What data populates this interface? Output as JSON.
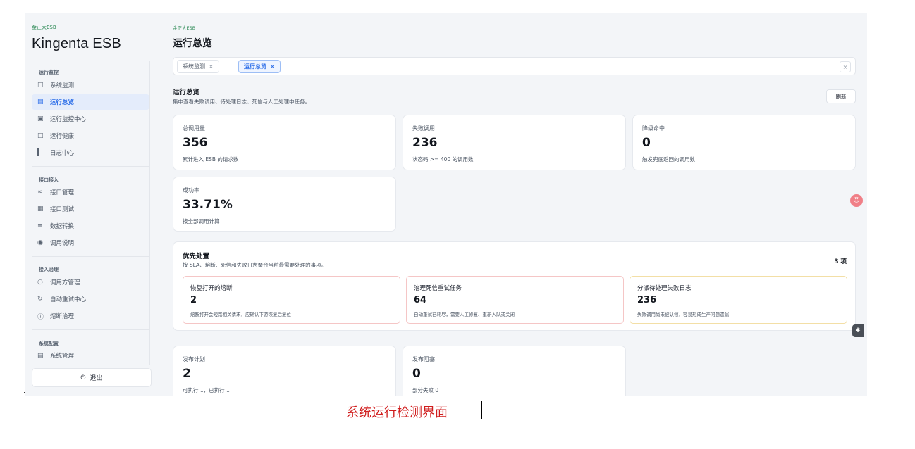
{
  "sidebar": {
    "brand_small": "金正大ESB",
    "brand_title": "Kingenta ESB",
    "groups": [
      {
        "title": "运行监控",
        "items": [
          {
            "label": "系统监测",
            "icon": "monitor-icon"
          },
          {
            "label": "运行总览",
            "icon": "dashboard-icon"
          },
          {
            "label": "运行监控中心",
            "icon": "screen-icon"
          },
          {
            "label": "运行健康",
            "icon": "health-icon"
          },
          {
            "label": "日志中心",
            "icon": "bar-chart-icon"
          }
        ]
      },
      {
        "title": "接口接入",
        "items": [
          {
            "label": "接口管理",
            "icon": "link-icon"
          },
          {
            "label": "接口测试",
            "icon": "test-icon"
          },
          {
            "label": "数据转换",
            "icon": "list-icon"
          },
          {
            "label": "调用说明",
            "icon": "doc-icon"
          }
        ]
      },
      {
        "title": "接入治理",
        "items": [
          {
            "label": "调用方管理",
            "icon": "user-icon"
          },
          {
            "label": "自动重试中心",
            "icon": "retry-icon"
          },
          {
            "label": "熔断治理",
            "icon": "info-icon"
          }
        ]
      },
      {
        "title": "系统配置",
        "items": [
          {
            "label": "系统管理",
            "icon": "settings-icon"
          }
        ]
      }
    ],
    "logout_label": "退出"
  },
  "header": {
    "crumb_small": "金正大ESB",
    "title": "运行总览"
  },
  "tabs": [
    {
      "label": "系统监测",
      "active": false
    },
    {
      "label": "运行总览",
      "active": true
    }
  ],
  "overview": {
    "title": "运行总览",
    "description": "集中查看失败调用、待处理日志、死信与人工处理中任务。",
    "refresh_label": "刷新"
  },
  "stats": [
    {
      "label": "总调用量",
      "value": "356",
      "desc": "累计进入 ESB 的请求数"
    },
    {
      "label": "失败调用",
      "value": "236",
      "desc": "状态码 >= 400 的调用数"
    },
    {
      "label": "降级命中",
      "value": "0",
      "desc": "触发兜底返回的调用数"
    },
    {
      "label": "成功率",
      "value": "33.71%",
      "desc": "按全部调用计算"
    }
  ],
  "priority": {
    "title": "优先处置",
    "description": "按 SLA、熔断、死信和失败日志聚合当前最需要处理的事项。",
    "count": "3 项",
    "items": [
      {
        "title": "恢复打开的熔断",
        "value": "2",
        "desc": "熔断打开会短路相关请求，应确认下游恢复后复位",
        "border_color": "#f5c6c6"
      },
      {
        "title": "治理死信重试任务",
        "value": "64",
        "desc": "自动重试已耗尽，需要人工修复、重新入队或关闭",
        "border_color": "#f5c6c6"
      },
      {
        "title": "分派待处理失败日志",
        "value": "236",
        "desc": "失败调用尚未被认领，容易形成生产问题遗漏",
        "border_color": "#f3dfa6"
      }
    ]
  },
  "release": [
    {
      "label": "发布计划",
      "value": "2",
      "desc": "可执行 1，已执行 1"
    },
    {
      "label": "发布阻塞",
      "value": "0",
      "desc": "部分失败 0"
    }
  ],
  "caption": "系统运行检测界面",
  "colors": {
    "accent": "#2b6de8",
    "brand_green": "#2d8a56",
    "caption_red": "#d01d1d"
  }
}
